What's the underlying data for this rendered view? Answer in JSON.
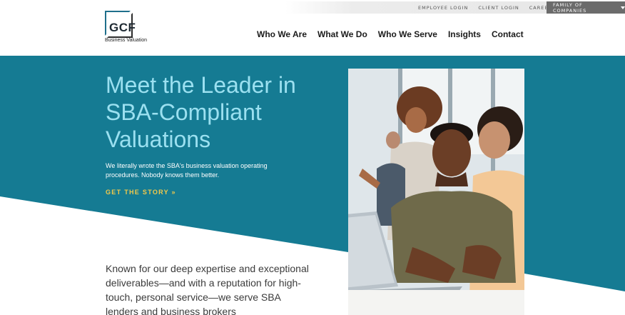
{
  "utility": {
    "links": [
      "EMPLOYEE LOGIN",
      "CLIENT LOGIN",
      "CAREERS"
    ],
    "family_button": "FAMILY OF COMPANIES"
  },
  "logo": {
    "mark": "GCF",
    "subtitle": "Business Valuation"
  },
  "nav": {
    "items": [
      "Who We Are",
      "What We Do",
      "Who We Serve",
      "Insights",
      "Contact"
    ]
  },
  "hero": {
    "title": "Meet the Leader in SBA-Compliant Valuations",
    "subtitle": "We literally wrote the SBA's business valuation operating procedures. Nobody knows them better.",
    "cta": "GET THE STORY »"
  },
  "intro": {
    "text": "Known for our deep expertise and exceptional deliverables—and with a reputation for high-touch, personal service—we serve SBA lenders and business brokers"
  },
  "colors": {
    "brand_teal": "#157b93",
    "title_blue": "#9be0f0",
    "cta_gold": "#f3c94a"
  }
}
